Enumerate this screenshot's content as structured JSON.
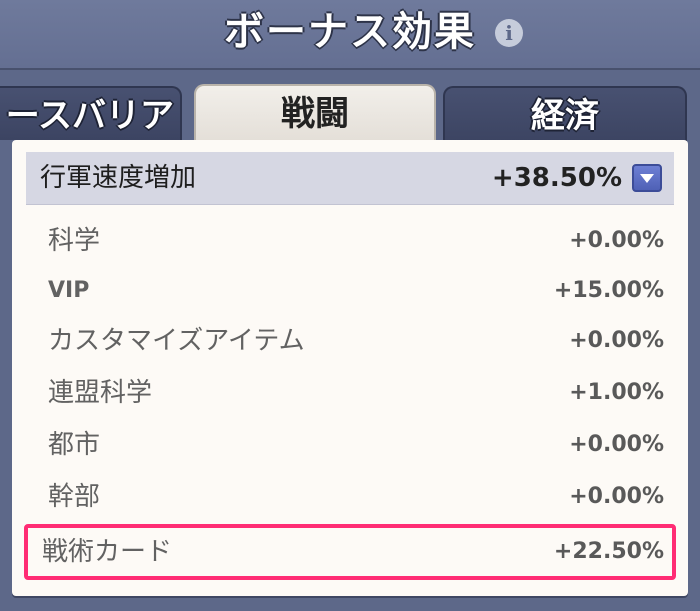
{
  "header": {
    "title": "ボーナス効果",
    "info_icon": "info-icon"
  },
  "tabs": [
    {
      "label": "ースバリア",
      "active": false
    },
    {
      "label": "戦闘",
      "active": true
    },
    {
      "label": "経済",
      "active": false
    }
  ],
  "panel": {
    "header_label": "行軍速度増加",
    "header_value": "+38.50%",
    "dropdown_icon": "chevron-down-icon",
    "rows": [
      {
        "label": "科学",
        "value": "+0.00%"
      },
      {
        "label": "VIP",
        "value": "+15.00%"
      },
      {
        "label": "カスタマイズアイテム",
        "value": "+0.00%"
      },
      {
        "label": "連盟科学",
        "value": "+1.00%"
      },
      {
        "label": "都市",
        "value": "+0.00%"
      },
      {
        "label": "幹部",
        "value": "+0.00%"
      }
    ],
    "highlighted_row": {
      "label": "戦術カード",
      "value": "+22.50%"
    }
  },
  "colors": {
    "background": "#5d6889",
    "highlight_border": "#ff2c74",
    "dropdown_button": "#5b6dc4"
  }
}
